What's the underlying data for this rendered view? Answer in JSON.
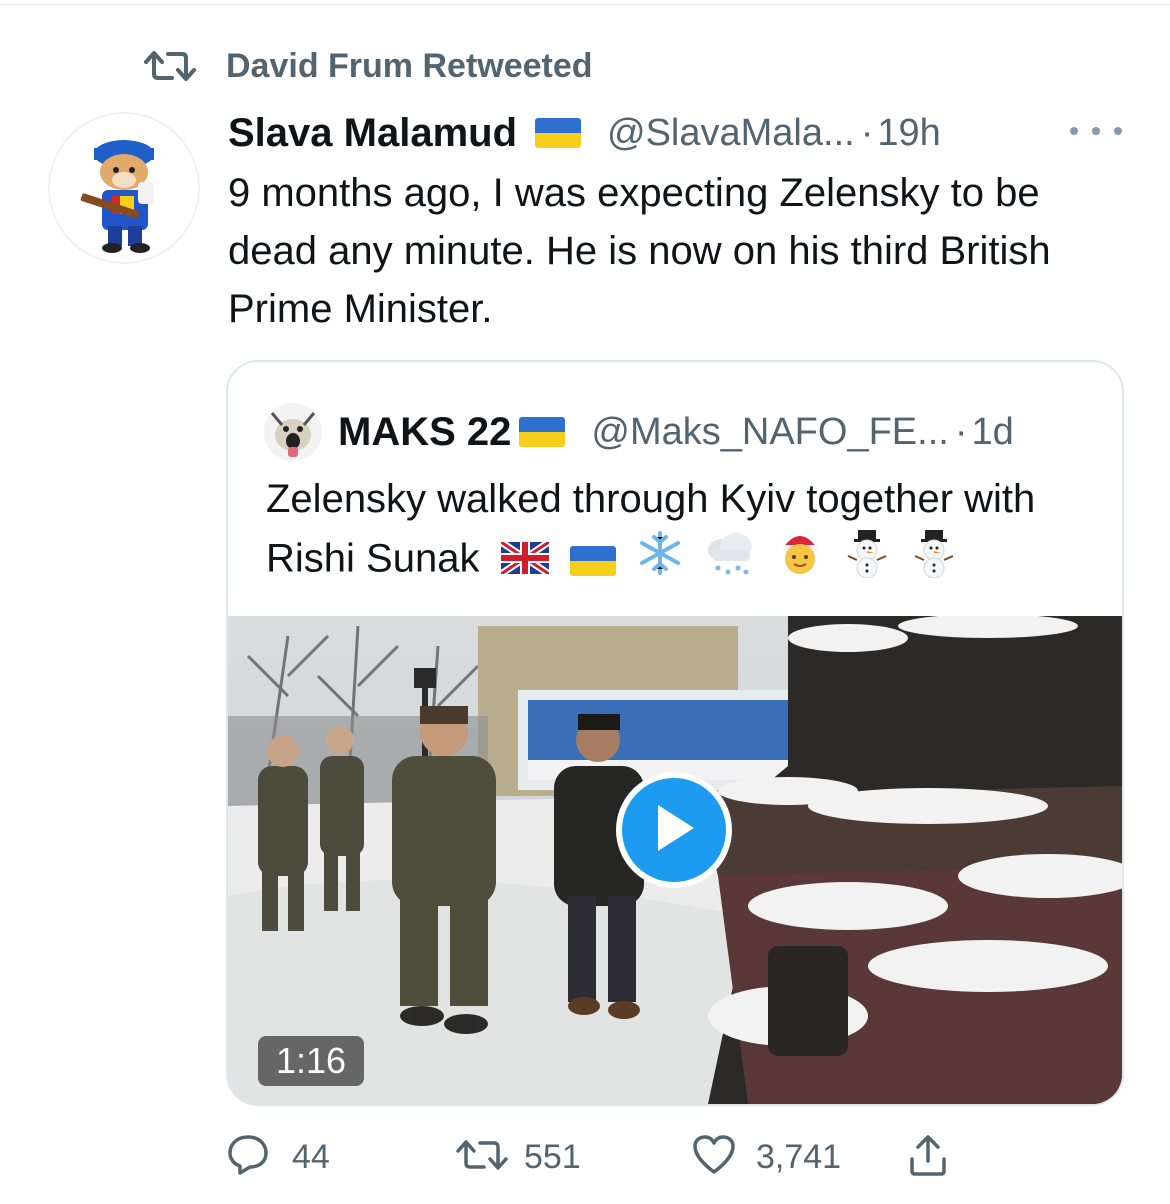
{
  "retweet_banner": {
    "icon": "retweet-icon",
    "text": "David Frum Retweeted"
  },
  "tweet": {
    "author_name": "Slava Malamud",
    "handle": "@SlavaMala...",
    "separator": "·",
    "time": "19h",
    "text": "9 months ago, I was expecting Zelensky to be dead any minute. He is now on his third British Prime Minister.",
    "more_icon": "more-icon"
  },
  "quoted_tweet": {
    "author_name": "MAKS 22",
    "handle": "@Maks_NAFO_FE...",
    "separator": "·",
    "time": "1d",
    "text": "Zelensky walked through Kyiv together with Rishi Sunak",
    "emojis": [
      "uk-flag",
      "ukraine-flag",
      "snowflake",
      "cloud-with-snow",
      "mrs-claus",
      "snowman",
      "snowman"
    ],
    "video": {
      "duration": "1:16",
      "play_icon": "play-icon"
    }
  },
  "actions": {
    "replies": "44",
    "retweets": "551",
    "likes": "3,741"
  },
  "colors": {
    "accent": "#1d9bf0",
    "secondary_text": "#536471",
    "primary_text": "#0f1419",
    "ukraine_blue": "#2f6fd0",
    "ukraine_yellow": "#f7cf1a"
  }
}
